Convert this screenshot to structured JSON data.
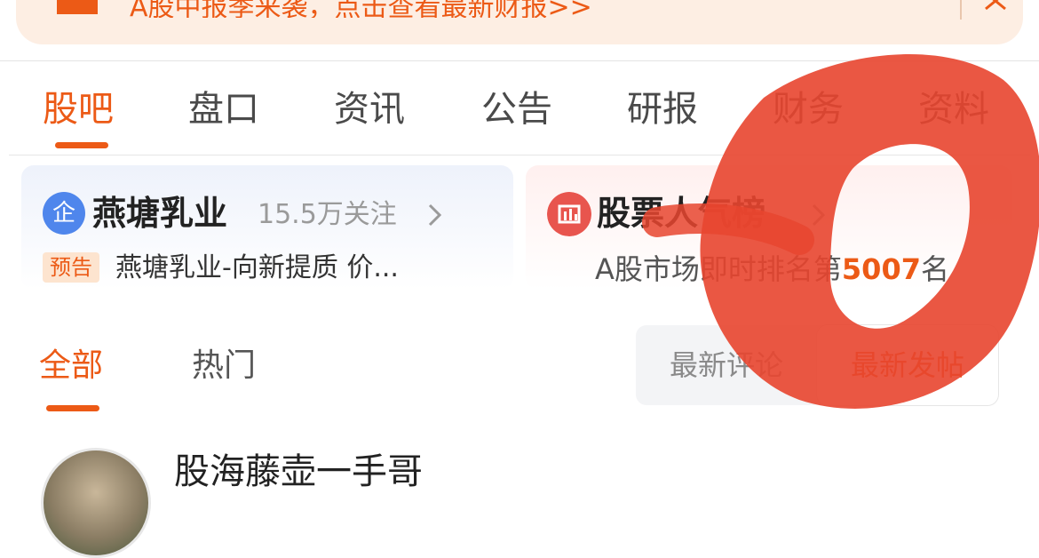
{
  "banner": {
    "text": "A股中报季来袭，点击查看最新财报>>",
    "close_icon": "close-icon",
    "megaphone_icon": "megaphone-icon"
  },
  "tabs": [
    {
      "label": "股吧",
      "active": true
    },
    {
      "label": "盘口"
    },
    {
      "label": "资讯"
    },
    {
      "label": "公告"
    },
    {
      "label": "研报"
    },
    {
      "label": "财务"
    },
    {
      "label": "资料"
    }
  ],
  "stock_card": {
    "icon_glyph": "企",
    "name": "燕塘乳业",
    "followers": "15.5万关注",
    "notice_badge": "预告",
    "notice_text": "燕塘乳业-向新提质 价..."
  },
  "rank_card": {
    "title": "股票人气榜",
    "prefix": "A股市场即时排名第",
    "rank": "5007",
    "suffix": "名"
  },
  "subtabs": {
    "all": "全部",
    "hot": "热门"
  },
  "sort": {
    "latest_comment": "最新评论",
    "latest_post": "最新发帖"
  },
  "post": {
    "author": "股海藤壶一手哥"
  },
  "colors": {
    "accent": "#ec5a16",
    "annotation": "#e8452f"
  }
}
